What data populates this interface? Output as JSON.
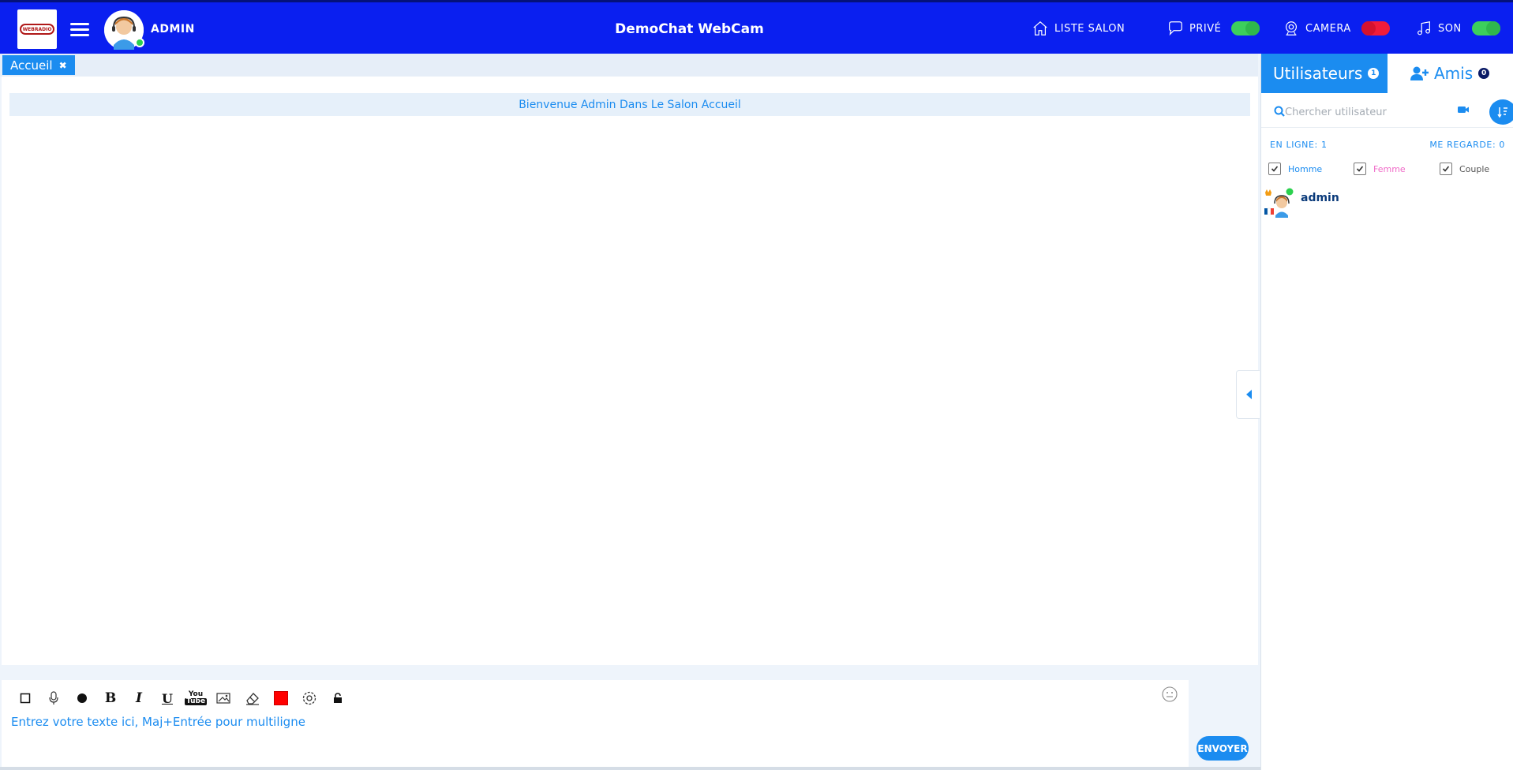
{
  "header": {
    "logo_text": "WEBRADIO",
    "username": "ADMIN",
    "site_title": "DemoChat WebCam",
    "items": {
      "rooms": {
        "label": "LISTE SALON",
        "icon": "home-icon"
      },
      "private": {
        "label": "PRIVÉ",
        "icon": "chat-bubble-icon",
        "toggle_state": "on",
        "toggle_color": "#3ccf5c"
      },
      "camera": {
        "label": "CAMERA",
        "icon": "webcam-icon",
        "toggle_state": "off",
        "toggle_color": "#f01c3a"
      },
      "sound": {
        "label": "SON",
        "icon": "music-note-icon",
        "toggle_state": "on",
        "toggle_color": "#3ccf5c"
      }
    }
  },
  "chat": {
    "tab_label": "Accueil",
    "welcome": "Bienvenue Admin Dans Le Salon Accueil"
  },
  "composer": {
    "placeholder": "Entrez votre texte ici, Maj+Entrée pour multiligne",
    "send_label": "ENVOYER",
    "tools": [
      "square-icon",
      "microphone-icon",
      "circle-icon",
      "bold-icon",
      "italic-icon",
      "underline-icon",
      "youtube-icon",
      "image-icon",
      "eraser-icon",
      "color-swatch",
      "settings-icon",
      "lock-icon"
    ],
    "bold_glyph": "B",
    "italic_glyph": "I",
    "underline_glyph": "U",
    "youtube_top": "You",
    "youtube_bottom": "Tube",
    "text_color": "#ff0000"
  },
  "panel": {
    "users_tab": "Utilisateurs",
    "users_count": "1",
    "friends_tab": "Amis",
    "friends_count": "0",
    "search_placeholder": "Chercher utilisateur",
    "online_label": "EN LIGNE: 1",
    "watching_label": "ME REGARDE: 0",
    "filters": [
      {
        "label": "Homme",
        "checked": true,
        "color": "#1b8cf0"
      },
      {
        "label": "Femme",
        "checked": true,
        "color": "#f06bc8"
      },
      {
        "label": "Couple",
        "checked": true,
        "color": "#555555"
      }
    ],
    "users": [
      {
        "name": "admin",
        "status": "online"
      }
    ]
  },
  "colors": {
    "header_bg": "#0a1ff0",
    "accent": "#1b8cf0",
    "online": "#2bd14e"
  }
}
